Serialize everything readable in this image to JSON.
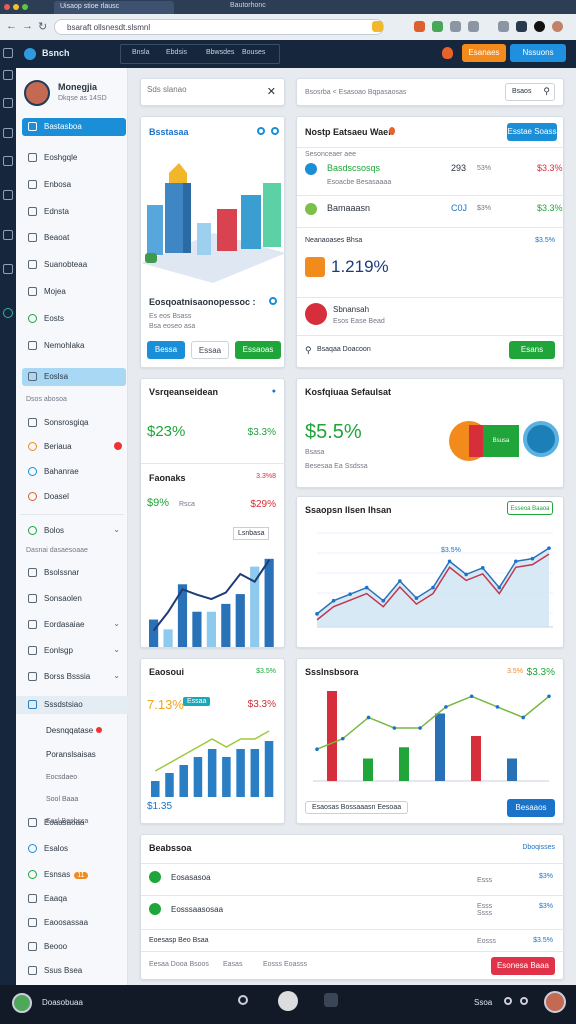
{
  "browser": {
    "window_title": "Bautorhonc",
    "tab_label": "Uisaop stioe rlausc",
    "url": "bsaraft ollsnesdt.slsmnl"
  },
  "header": {
    "app_name": "Bsnch",
    "nav": [
      "Bnsla",
      "Ebdsis",
      "Bbwsdes",
      "Bouses"
    ],
    "btn_orange": "Esanaes",
    "btn_blue": "Nssuons"
  },
  "profile": {
    "name": "Monegjia",
    "subtitle": "Dkqse as 14SD"
  },
  "sidebar": {
    "items": [
      "Bastasboa",
      "Eoshgqle",
      "Enbosa",
      "Ednsta",
      "Beaoat",
      "Suanobteaa",
      "Mojea",
      "Eosts",
      "Nemohlaka"
    ],
    "section": "Eoslsa",
    "section_caption": "Dsos abosoa",
    "items2": [
      "Sonsrosgiqa",
      "Beriaua",
      "Bahanrae",
      "Doasel"
    ],
    "items3": [
      "Bolos",
      "Bsolssnar",
      "Sonsaolen",
      "Eordasaiae",
      "Eonlsgp",
      "Borss Bsssia",
      "Sssdstsiao"
    ],
    "captions": [
      "Dasnai dasaesoaae"
    ],
    "sub": [
      "Desnqqatase",
      "Poranslsaisas",
      "Eocsdaeo",
      "Sool Baaa",
      "Easl Besbsca"
    ],
    "bottom": [
      "Eoaasaoaa",
      "Esalos",
      "Esnsas",
      "Eaaqa",
      "Eaoosassaa",
      "Beooo",
      "Ssus Bsea"
    ],
    "badge": "11"
  },
  "search_card": {
    "placeholder": "Sds slanao"
  },
  "filter_card": {
    "crumb": "Bsosrba  <  Esasoao Bqpasaosas",
    "btn": "Bsaos"
  },
  "illustration_card": {
    "title": "Bsstasaa",
    "caption": "Eosqoatnisaonopessoc :",
    "meta1": "Es eos Bsass",
    "meta2": "Bsa eoseo asa",
    "btn1": "Bessa",
    "btn2": "Essaa",
    "btn3": "Essaoas"
  },
  "list_card": {
    "title": "Nostp Eatsaeu Waen",
    "btn": "Esstae Soass",
    "caption": "Sesonceaer aee",
    "rows": [
      {
        "name": "Basdscsosqs",
        "sub": "Esoacbe Besasaaaa",
        "num": "293",
        "mid": "53%",
        "val": "$3.3%"
      },
      {
        "name": "Bamaaasn",
        "sub": "",
        "num": "C0J",
        "mid": "$3%",
        "val": "$3.3%"
      }
    ],
    "kpi_label": "Neanaoases Bhsa",
    "kpi_right": "$3.5%",
    "kpi_value": "1.219%",
    "person": "Sbnansah",
    "person_sub": "Esos Ease Bead",
    "footer": "Bsaqaa Doacoon",
    "footer_btn": "Esans"
  },
  "metric_card": {
    "title": "Vsrqeanseidean",
    "value": "$23%",
    "right": "$3.3%",
    "sub_title": "Faonaks",
    "sub_right": "3.3%8",
    "v2": "$9%",
    "v2_sub": "Rsca",
    "v2_right": "$29%",
    "legend": "Lsnbasa"
  },
  "revenue_card": {
    "title": "Kosfqiuaa Sefaulsat",
    "value": "$5.5%",
    "sub1": "Bsasa",
    "sub2": "Besesaa Ea Ssdssa",
    "badge": "Bsusa"
  },
  "line_card": {
    "title": "Ssaopsn Ilsen Ihsan",
    "btn": "Esseoa Baaoa",
    "peak": "$3.5%"
  },
  "bar_card": {
    "title": "Eaosoui",
    "right": "$3.5%",
    "value": "7.13%",
    "badge": "Essaa",
    "right2": "$3.3%",
    "low": "$1.35"
  },
  "mixed_card": {
    "title": "Ssslnsbsora",
    "r1": "3.5%",
    "r2": "$3.3%",
    "footer": "Esaosas Bossaaasn Eesoaa",
    "btn": "Besaaos"
  },
  "table_card": {
    "title": "Beabssoa",
    "link": "Dboqisses",
    "rows": [
      {
        "name": "Eosasasoa",
        "v1": "Esss",
        "v2": "$3%"
      },
      {
        "name": "Eosssaasosaa",
        "v1": "Esss\nSsss",
        "v2": "$3%"
      }
    ],
    "footer": "Eoesasp Beo Bsaa",
    "footer_v1": "Eosss",
    "footer_v2": "$3.5%",
    "bottom_left": [
      "Eesaa Dooa Bsoos",
      "Easas",
      "Eosss Eoasss"
    ],
    "bottom_btn": "Esonesa Baaa"
  },
  "taskbar": {
    "label": "Doasobuaa",
    "right": "Ssoa"
  },
  "colors": {
    "accent": "#1a8fd8",
    "green": "#1fa53a",
    "red": "#d62e3a",
    "orange": "#f28a1c",
    "dark": "#16263c"
  },
  "chart_data": [
    {
      "type": "bar",
      "values": [
        14,
        9,
        32,
        18,
        18,
        22,
        27,
        41,
        45
      ]
    },
    {
      "type": "line",
      "values": [
        1.5,
        3.2,
        5.3,
        4.8,
        4.4,
        5.0,
        6.7,
        6.0,
        8.0
      ]
    },
    {
      "type": "area",
      "values": [
        1,
        2,
        2.5,
        3,
        2,
        3.5,
        2.2,
        3,
        5,
        4,
        4.5,
        3,
        5,
        5.2,
        6
      ]
    },
    {
      "type": "bar",
      "values": [
        2,
        3,
        4,
        5,
        6,
        5,
        6,
        6,
        7
      ]
    },
    {
      "type": "bar",
      "values": [
        8,
        2,
        3,
        6,
        4,
        2
      ]
    },
    {
      "type": "line",
      "values": [
        3,
        4,
        6,
        5,
        5,
        7,
        8,
        7,
        6,
        8
      ]
    }
  ]
}
